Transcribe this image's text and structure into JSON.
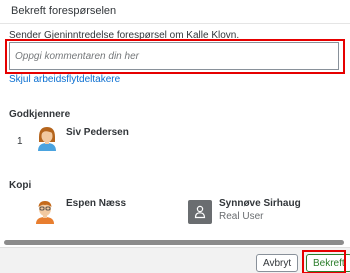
{
  "dialog": {
    "title": "Bekreft forespørselen"
  },
  "request": {
    "text": "Sender Gjeninntredelse forespørsel om Kalle Klovn.",
    "comment_placeholder": "Oppgi kommentaren din her",
    "comment_value": "",
    "toggle_participants_label": "Skjul arbeidsflytdeltakere"
  },
  "approvers": {
    "heading": "Godkjennere",
    "items": [
      {
        "step": "1",
        "name": "Siv Pedersen",
        "avatar": "female-avatar-icon"
      }
    ]
  },
  "copies": {
    "heading": "Kopi",
    "items": [
      {
        "name": "Espen Næss",
        "role": "",
        "avatar": "male-avatar-icon"
      },
      {
        "name": "Synnøve Sirhaug",
        "role": "Real User",
        "avatar": "person-placeholder-icon"
      }
    ]
  },
  "footer": {
    "cancel_label": "Avbryt",
    "confirm_label": "Bekreft"
  },
  "colors": {
    "link": "#0a6ed1",
    "highlight": "#e60000",
    "confirm": "#2b7d2b",
    "footer_bg": "#f2f2f2"
  }
}
